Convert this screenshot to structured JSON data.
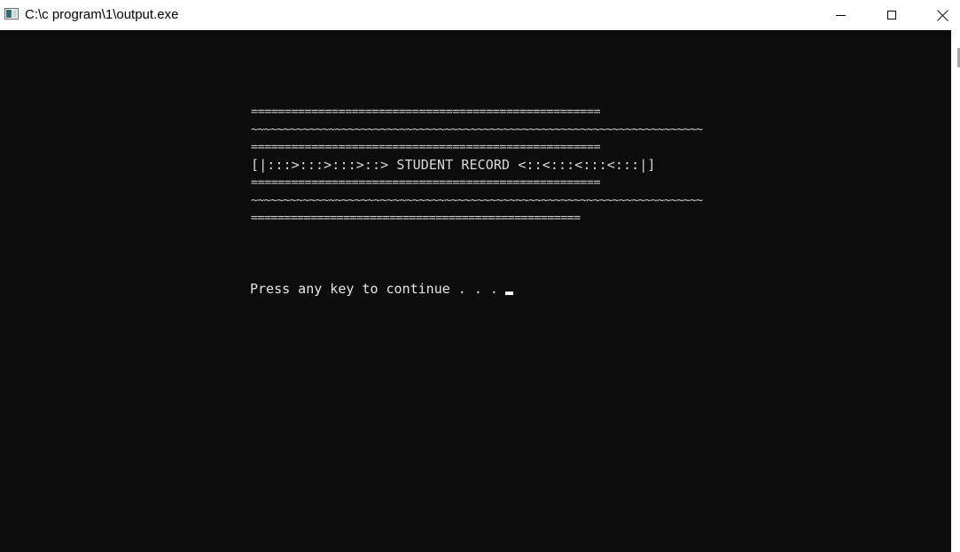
{
  "window": {
    "title": "C:\\c program\\1\\output.exe",
    "icon": "console-app-icon",
    "controls": {
      "minimize_icon": "minimize-icon",
      "maximize_icon": "maximize-icon",
      "close_icon": "close-icon"
    }
  },
  "console": {
    "background": "#0c0c0c",
    "foreground": "#cccccc",
    "lines": [
      "====================================================",
      "~~~~~~~~~~~~~~~~~~~~~~~~~~~~~~~~~~~~~~~~~~~~~~~~~~~~~~~~~~~~~~~~~~~~~~",
      "====================================================",
      "[|:::>:::>:::>::> STUDENT RECORD <::<:::<:::<:::|]",
      "====================================================",
      "~~~~~~~~~~~~~~~~~~~~~~~~~~~~~~~~~~~~~~~~~~~~~~~~~~~~~~~~~~~~~~~~~~~~~~",
      "=================================================="
    ],
    "prompt": "Press any key to continue . . ."
  }
}
